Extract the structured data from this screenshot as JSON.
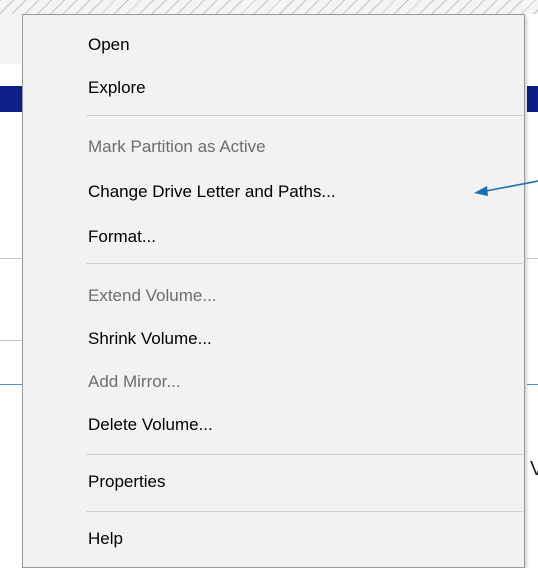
{
  "context_menu": {
    "items": [
      {
        "label": "Open",
        "enabled": true
      },
      {
        "label": "Explore",
        "enabled": true
      },
      {
        "label": "Mark Partition as Active",
        "enabled": false
      },
      {
        "label": "Change Drive Letter and Paths...",
        "enabled": true
      },
      {
        "label": "Format...",
        "enabled": true
      },
      {
        "label": "Extend Volume...",
        "enabled": false
      },
      {
        "label": "Shrink Volume...",
        "enabled": true
      },
      {
        "label": "Add Mirror...",
        "enabled": false
      },
      {
        "label": "Delete Volume...",
        "enabled": true
      },
      {
        "label": "Properties",
        "enabled": true
      },
      {
        "label": "Help",
        "enabled": true
      }
    ]
  },
  "background": {
    "right_edge_char": "V"
  },
  "annotation": {
    "icon": "arrow-left-icon",
    "color": "#1a6fb5"
  }
}
